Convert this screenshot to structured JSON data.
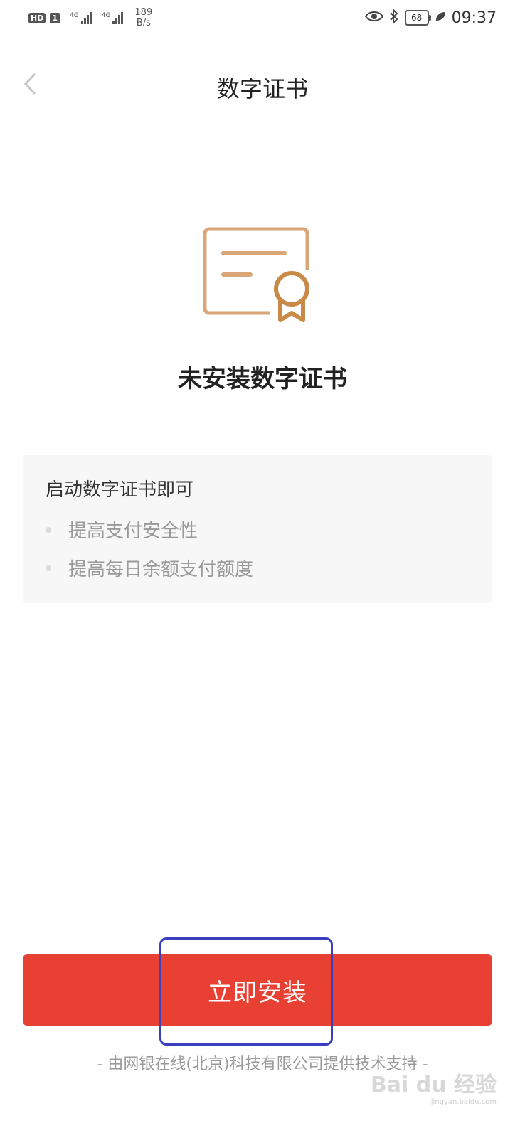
{
  "status_bar": {
    "hd": "HD",
    "sim": "1",
    "net1": "4G",
    "net2": "4G",
    "speed_value": "189",
    "speed_unit": "B/s",
    "battery": "68",
    "time": "09:37"
  },
  "header": {
    "title": "数字证书"
  },
  "main": {
    "status_title": "未安装数字证书",
    "card": {
      "title": "启动数字证书即可",
      "bullets": [
        "提高支付安全性",
        "提高每日余额支付额度"
      ]
    }
  },
  "install_button": {
    "label": "立即安装"
  },
  "footer": {
    "text": "- 由网银在线(北京)科技有限公司提供技术支持 -"
  },
  "watermark": {
    "brand": "Bai du 经验",
    "url": "jingyan.baidu.com"
  },
  "colors": {
    "accent": "#e84134",
    "icon": "#d9a777",
    "highlight": "#3a3fbf"
  },
  "icons": [
    "back-arrow-icon",
    "eye-icon",
    "bluetooth-icon",
    "battery-icon",
    "leaf-icon",
    "certificate-icon"
  ]
}
